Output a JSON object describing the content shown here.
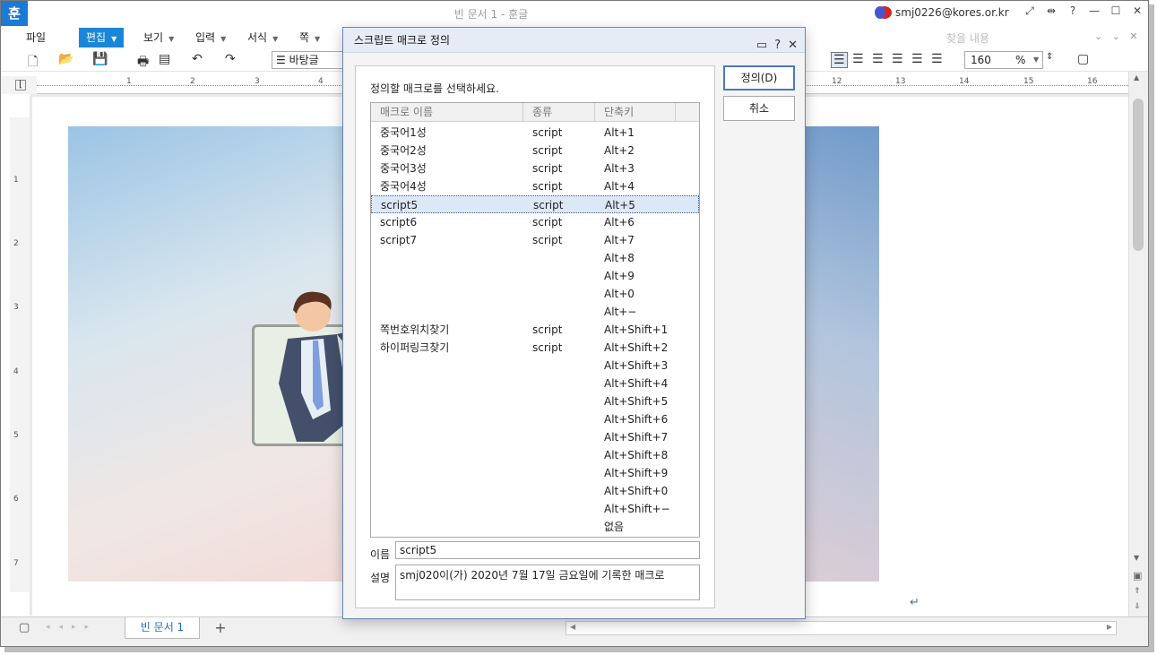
{
  "window": {
    "title": "빈 문서 1 - 훈글",
    "user": "smj0226@kores.or.kr",
    "logo": "훈"
  },
  "menus": [
    {
      "label": "파일"
    },
    {
      "label": "편집"
    },
    {
      "label": "보기"
    },
    {
      "label": "입력"
    },
    {
      "label": "서식"
    },
    {
      "label": "쪽"
    }
  ],
  "toolbar": {
    "style_value": "바탕글",
    "zoom_value": "160",
    "zoom_unit": "%"
  },
  "ribbon_search_placeholder": "찾을 내용",
  "ruler": {
    "h_ticks": [
      "1",
      "2",
      "3",
      "4",
      "12",
      "13",
      "14",
      "15",
      "16"
    ],
    "v_ticks": [
      "1",
      "2",
      "3",
      "4",
      "5",
      "6",
      "7"
    ]
  },
  "tabs": {
    "doc_tab": "빈 문서 1",
    "add": "+"
  },
  "dialog": {
    "title": "스크립트 매크로 정의",
    "prompt": "정의할 매크로를 선택하세요.",
    "columns": [
      "매크로 이름",
      "종류",
      "단축키"
    ],
    "rows": [
      {
        "name": "중국어1성",
        "type": "script",
        "key": "Alt+1"
      },
      {
        "name": "중국어2성",
        "type": "script",
        "key": "Alt+2"
      },
      {
        "name": "중국어3성",
        "type": "script",
        "key": "Alt+3"
      },
      {
        "name": "중국어4성",
        "type": "script",
        "key": "Alt+4"
      },
      {
        "name": "script5",
        "type": "script",
        "key": "Alt+5",
        "selected": true
      },
      {
        "name": "script6",
        "type": "script",
        "key": "Alt+6"
      },
      {
        "name": "script7",
        "type": "script",
        "key": "Alt+7"
      },
      {
        "name": "",
        "type": "",
        "key": "Alt+8"
      },
      {
        "name": "",
        "type": "",
        "key": "Alt+9"
      },
      {
        "name": "",
        "type": "",
        "key": "Alt+0"
      },
      {
        "name": "",
        "type": "",
        "key": "Alt+−"
      },
      {
        "name": "쪽번호위치찾기",
        "type": "script",
        "key": "Alt+Shift+1"
      },
      {
        "name": "하이퍼링크찾기",
        "type": "script",
        "key": "Alt+Shift+2"
      },
      {
        "name": "",
        "type": "",
        "key": "Alt+Shift+3"
      },
      {
        "name": "",
        "type": "",
        "key": "Alt+Shift+4"
      },
      {
        "name": "",
        "type": "",
        "key": "Alt+Shift+5"
      },
      {
        "name": "",
        "type": "",
        "key": "Alt+Shift+6"
      },
      {
        "name": "",
        "type": "",
        "key": "Alt+Shift+7"
      },
      {
        "name": "",
        "type": "",
        "key": "Alt+Shift+8"
      },
      {
        "name": "",
        "type": "",
        "key": "Alt+Shift+9"
      },
      {
        "name": "",
        "type": "",
        "key": "Alt+Shift+0"
      },
      {
        "name": "",
        "type": "",
        "key": "Alt+Shift+−"
      },
      {
        "name": "",
        "type": "",
        "key": "없음"
      }
    ],
    "name_label": "이름",
    "name_value": "script5",
    "desc_label": "설명",
    "desc_value": "smj020이(가) 2020년 7월 17일 금요일에 기록한 매크로",
    "ok_button": "정의(D)",
    "cancel_button": "취소"
  },
  "colors": {
    "accent": "#1a86d8",
    "dialog_border": "#6b86b8",
    "selection": "#dde8f6"
  }
}
